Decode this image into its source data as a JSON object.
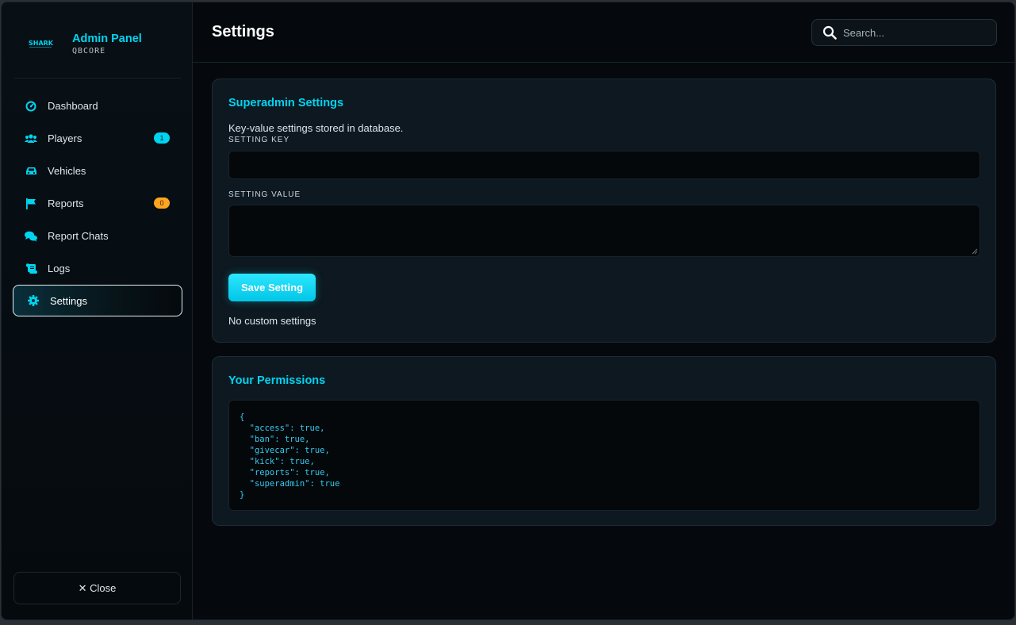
{
  "brand": {
    "title": "Admin Panel",
    "subtitle": "QBCORE",
    "logo_text": "SHARK"
  },
  "nav": {
    "items": [
      {
        "label": "Dashboard",
        "icon": "gauge-icon"
      },
      {
        "label": "Players",
        "icon": "users-icon",
        "badge": "1"
      },
      {
        "label": "Vehicles",
        "icon": "car-icon"
      },
      {
        "label": "Reports",
        "icon": "flag-icon",
        "badge": "0"
      },
      {
        "label": "Report Chats",
        "icon": "chat-icon"
      },
      {
        "label": "Logs",
        "icon": "scroll-icon"
      },
      {
        "label": "Settings",
        "icon": "gear-icon",
        "active": true
      }
    ],
    "close_label": "✕ Close"
  },
  "header": {
    "title": "Settings",
    "search_placeholder": "Search..."
  },
  "superadmin": {
    "title": "Superadmin Settings",
    "description": "Key-value settings stored in database.",
    "key_label": "SETTING KEY",
    "value_label": "SETTING VALUE",
    "key_value": "",
    "value_value": "",
    "save_label": "Save Setting",
    "empty_note": "No custom settings"
  },
  "permissions": {
    "title": "Your Permissions",
    "json_lines": [
      "{",
      "  \"access\": true,",
      "  \"ban\": true,",
      "  \"givecar\": true,",
      "  \"kick\": true,",
      "  \"reports\": true,",
      "  \"superadmin\": true",
      "}"
    ]
  },
  "colors": {
    "accent": "#00d4f0",
    "badge_orange": "#ffa51f",
    "background": "#05090d",
    "card": "#0d1820"
  }
}
